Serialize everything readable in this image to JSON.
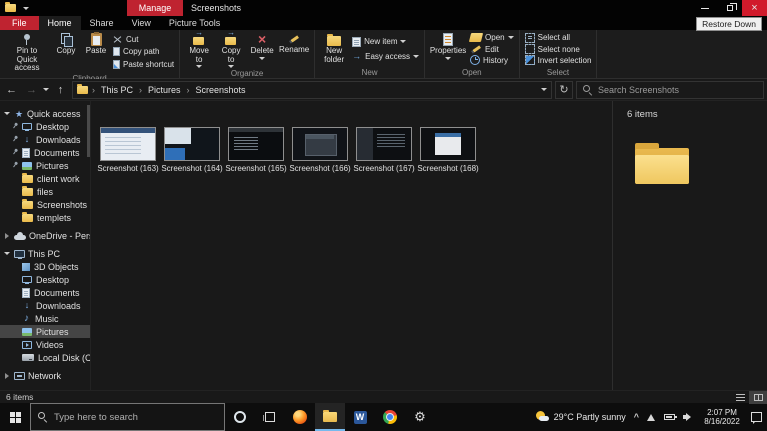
{
  "titlebar": {
    "contextual_tab": "Manage",
    "title": "Screenshots",
    "tooltip": "Restore Down"
  },
  "ribbon": {
    "file_tab": "File",
    "tabs": {
      "home": "Home",
      "share": "Share",
      "view": "View",
      "picture_tools": "Picture Tools"
    },
    "clipboard": {
      "label": "Clipboard",
      "pin": "Pin to Quick access",
      "copy": "Copy",
      "paste": "Paste",
      "cut": "Cut",
      "copy_path": "Copy path",
      "paste_shortcut": "Paste shortcut"
    },
    "organize": {
      "label": "Organize",
      "move_to": "Move to",
      "copy_to": "Copy to",
      "delete": "Delete",
      "rename": "Rename"
    },
    "new": {
      "label": "New",
      "new_folder": "New folder",
      "new_item": "New item",
      "easy_access": "Easy access"
    },
    "open": {
      "label": "Open",
      "properties": "Properties",
      "open": "Open",
      "edit": "Edit",
      "history": "History"
    },
    "select": {
      "label": "Select",
      "select_all": "Select all",
      "select_none": "Select none",
      "invert_selection": "Invert selection"
    }
  },
  "addressbar": {
    "crumbs": [
      "This PC",
      "Pictures",
      "Screenshots"
    ],
    "search_placeholder": "Search Screenshots"
  },
  "sidebar": {
    "quick_access": {
      "label": "Quick access",
      "items": [
        {
          "label": "Desktop"
        },
        {
          "label": "Downloads"
        },
        {
          "label": "Documents"
        },
        {
          "label": "Pictures"
        },
        {
          "label": "client work"
        },
        {
          "label": "files"
        },
        {
          "label": "Screenshots"
        },
        {
          "label": "templets"
        }
      ]
    },
    "onedrive": {
      "label": "OneDrive - Personal"
    },
    "this_pc": {
      "label": "This PC",
      "items": [
        {
          "label": "3D Objects"
        },
        {
          "label": "Desktop"
        },
        {
          "label": "Documents"
        },
        {
          "label": "Downloads"
        },
        {
          "label": "Music"
        },
        {
          "label": "Pictures"
        },
        {
          "label": "Videos"
        },
        {
          "label": "Local Disk (C:)"
        }
      ]
    },
    "network": {
      "label": "Network"
    }
  },
  "files": {
    "items": [
      "Screenshot (163)",
      "Screenshot (164)",
      "Screenshot (165)",
      "Screenshot (166)",
      "Screenshot (167)",
      "Screenshot (168)"
    ]
  },
  "preview_pane": {
    "count": "6 items"
  },
  "statusbar": {
    "count": "6 items"
  },
  "taskbar": {
    "search_placeholder": "Type here to search",
    "word_initial": "W",
    "weather_label": "29°C Partly sunny",
    "clock_time": "2:07 PM",
    "clock_date": "8/16/2022"
  }
}
